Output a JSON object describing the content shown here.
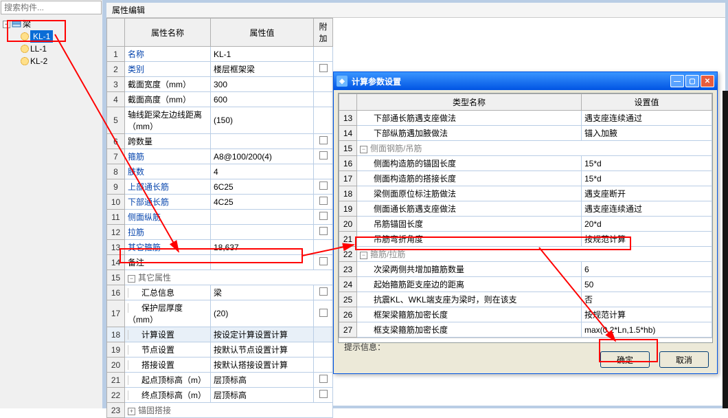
{
  "search": {
    "placeholder": "搜索构件...",
    "icon": "search-icon"
  },
  "tree": {
    "root_label": "梁",
    "items": [
      "KL-1",
      "LL-1",
      "KL-2"
    ]
  },
  "panel_title": "属性编辑",
  "prop_headers": {
    "name": "属性名称",
    "value": "属性值",
    "extra": "附加"
  },
  "prop_rows": [
    {
      "n": "1",
      "name": "名称",
      "value": "KL-1",
      "link": true,
      "extra": ""
    },
    {
      "n": "2",
      "name": "类别",
      "value": "楼层框架梁",
      "link": true,
      "extra": "chk"
    },
    {
      "n": "3",
      "name": "截面宽度（mm）",
      "value": "300",
      "link": false,
      "extra": ""
    },
    {
      "n": "4",
      "name": "截面高度（mm）",
      "value": "600",
      "link": false,
      "extra": ""
    },
    {
      "n": "5",
      "name": "轴线距梁左边线距离（mm）",
      "value": "(150)",
      "link": false,
      "extra": ""
    },
    {
      "n": "6",
      "name": "跨数量",
      "value": "",
      "link": false,
      "extra": "chk"
    },
    {
      "n": "7",
      "name": "箍筋",
      "value": "A8@100/200(4)",
      "link": true,
      "extra": "chk"
    },
    {
      "n": "8",
      "name": "肢数",
      "value": "4",
      "link": true,
      "extra": ""
    },
    {
      "n": "9",
      "name": "上部通长筋",
      "value": "6C25",
      "link": true,
      "extra": "chk"
    },
    {
      "n": "10",
      "name": "下部通长筋",
      "value": "4C25",
      "link": true,
      "extra": "chk"
    },
    {
      "n": "11",
      "name": "侧面纵筋",
      "value": "",
      "link": true,
      "extra": "chk"
    },
    {
      "n": "12",
      "name": "拉筋",
      "value": "",
      "link": true,
      "extra": "chk"
    },
    {
      "n": "13",
      "name": "其它箍筋",
      "value": "18,637",
      "link": true,
      "extra": ""
    },
    {
      "n": "14",
      "name": "备注",
      "value": "",
      "link": false,
      "extra": "chk"
    },
    {
      "n": "15",
      "name": "其它属性",
      "value": "",
      "group": "minus"
    },
    {
      "n": "16",
      "name": "汇总信息",
      "value": "梁",
      "link": false,
      "extra": "chk",
      "indent": true
    },
    {
      "n": "17",
      "name": "保护层厚度（mm）",
      "value": "(20)",
      "link": false,
      "extra": "chk",
      "indent": true
    },
    {
      "n": "18",
      "name": "计算设置",
      "value": "按设定计算设置计算",
      "highlight": true,
      "indent": true
    },
    {
      "n": "19",
      "name": "节点设置",
      "value": "按默认节点设置计算",
      "indent": true
    },
    {
      "n": "20",
      "name": "搭接设置",
      "value": "按默认搭接设置计算",
      "indent": true
    },
    {
      "n": "21",
      "name": "起点顶标高（m）",
      "value": "层顶标高",
      "extra": "chk",
      "indent": true
    },
    {
      "n": "22",
      "name": "终点顶标高（m）",
      "value": "层顶标高",
      "extra": "chk",
      "indent": true
    },
    {
      "n": "23",
      "name": "锚固搭接",
      "value": "",
      "group": "plus"
    }
  ],
  "dialog": {
    "title": "计算参数设置",
    "headers": {
      "col1": "类型名称",
      "col2": "设置值"
    },
    "rows": [
      {
        "n": "13",
        "name": "下部通长筋遇支座做法",
        "value": "遇支座连续通过",
        "indent": true
      },
      {
        "n": "14",
        "name": "下部纵筋遇加腋做法",
        "value": "锚入加腋",
        "indent": true
      },
      {
        "n": "15",
        "name": "侧面钢筋/吊筋",
        "group": "minus",
        "gray": true
      },
      {
        "n": "16",
        "name": "侧面构造筋的锚固长度",
        "value": "15*d",
        "indent": true
      },
      {
        "n": "17",
        "name": "侧面构造筋的搭接长度",
        "value": "15*d",
        "indent": true
      },
      {
        "n": "18",
        "name": "梁侧面原位标注筋做法",
        "value": "遇支座断开",
        "indent": true
      },
      {
        "n": "19",
        "name": "侧面通长筋遇支座做法",
        "value": "遇支座连续通过",
        "indent": true
      },
      {
        "n": "20",
        "name": "吊筋锚固长度",
        "value": "20*d",
        "indent": true
      },
      {
        "n": "21",
        "name": "吊筋弯折角度",
        "value": "按规范计算",
        "indent": true
      },
      {
        "n": "22",
        "name": "箍筋/拉筋",
        "group": "minus",
        "gray": true
      },
      {
        "n": "23",
        "name": "次梁两侧共增加箍筋数量",
        "value": "6",
        "indent": true
      },
      {
        "n": "24",
        "name": "起始箍筋距支座边的距离",
        "value": "50",
        "indent": true
      },
      {
        "n": "25",
        "name": "抗震KL、WKL端支座为梁时，则在该支",
        "value": "否",
        "indent": true
      },
      {
        "n": "26",
        "name": "框架梁箍筋加密长度",
        "value": "按规范计算",
        "indent": true
      },
      {
        "n": "27",
        "name": "框支梁箍筋加密长度",
        "value": "max(0.2*Ln,1.5*hb)",
        "indent": true
      }
    ],
    "hint_label": "提示信息：",
    "ok_label": "确定",
    "cancel_label": "取消"
  }
}
